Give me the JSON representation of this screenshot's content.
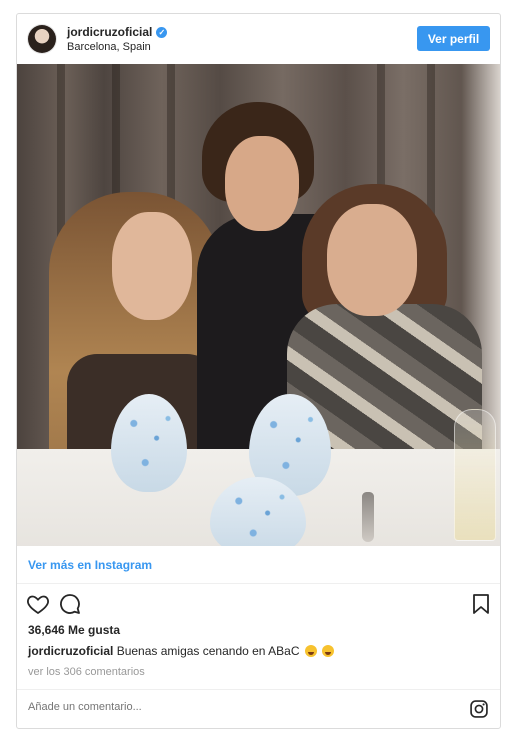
{
  "header": {
    "username": "jordicruzoficial",
    "location": "Barcelona, Spain",
    "view_profile_label": "Ver perfil",
    "verified_mark": "✓"
  },
  "post": {
    "view_more_label": "Ver más en Instagram",
    "likes": "36,646 Me gusta",
    "caption_user": "jordicruzoficial",
    "caption_text": "Buenas amigas cenando en ABaC",
    "comments_link": "ver los 306 comentarios"
  },
  "comment": {
    "placeholder": "Añade un comentario..."
  },
  "colors": {
    "accent": "#3897f0",
    "text": "#262626",
    "muted": "#999999"
  },
  "icons": [
    "verified-badge-icon",
    "heart-icon",
    "comment-icon",
    "bookmark-icon",
    "instagram-logo-icon"
  ]
}
